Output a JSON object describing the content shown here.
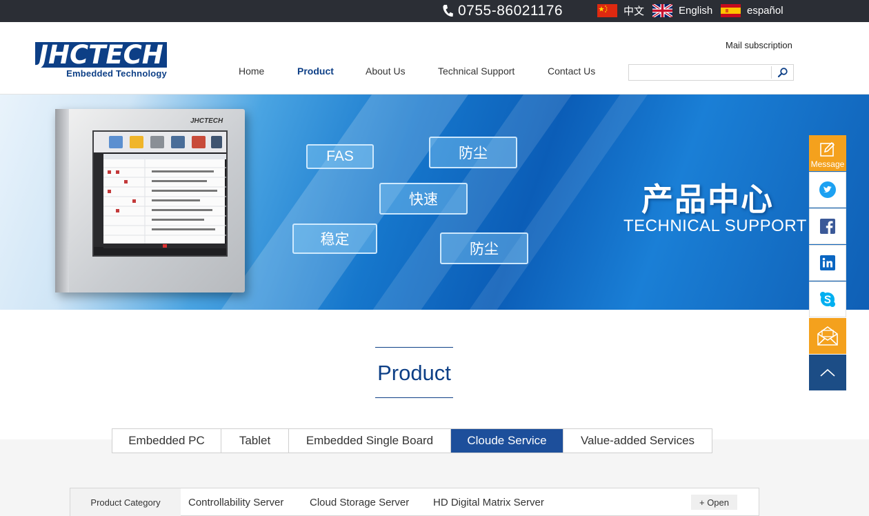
{
  "topbar": {
    "phone": "0755-86021176",
    "languages": [
      {
        "label": "中文",
        "flag": "china-flag-icon"
      },
      {
        "label": "English",
        "flag": "uk-flag-icon"
      },
      {
        "label": "español",
        "flag": "spain-flag-icon"
      }
    ]
  },
  "header": {
    "logo_main": "JHCTECH",
    "logo_sub": "Embedded Technology",
    "mail_subscription": "Mail subscription",
    "search_placeholder": "",
    "nav": [
      {
        "label": "Home",
        "active": false
      },
      {
        "label": "Product",
        "active": true
      },
      {
        "label": "About Us",
        "active": false
      },
      {
        "label": "Technical Support",
        "active": false
      },
      {
        "label": "Contact Us",
        "active": false
      }
    ]
  },
  "banner": {
    "title": "产品中心",
    "subtitle": "TECHNICAL SUPPORT",
    "device_brand": "JHCTECH",
    "chips": [
      "FAS",
      "防尘",
      "快速",
      "稳定",
      "防尘"
    ]
  },
  "product": {
    "title": "Product",
    "tabs": [
      {
        "label": "Embedded PC",
        "active": false
      },
      {
        "label": "Tablet",
        "active": false
      },
      {
        "label": "Embedded Single Board",
        "active": false
      },
      {
        "label": "Cloude Service",
        "active": true
      },
      {
        "label": "Value-added Services",
        "active": false
      }
    ],
    "category_label": "Product Category",
    "categories": [
      "Controllability Server",
      "Cloud Storage Server",
      "HD Digital Matrix Server"
    ],
    "open_label": "+ Open"
  },
  "sidebar": {
    "message_label": "Message",
    "items": [
      "message-icon",
      "twitter-icon",
      "facebook-icon",
      "linkedin-icon",
      "skype-icon",
      "mail-icon",
      "back-to-top-icon"
    ]
  },
  "colors": {
    "navy": "#0d3f86",
    "tab_active": "#1d4f9b",
    "orange": "#f4a11d",
    "topbar": "#2b2e35"
  }
}
